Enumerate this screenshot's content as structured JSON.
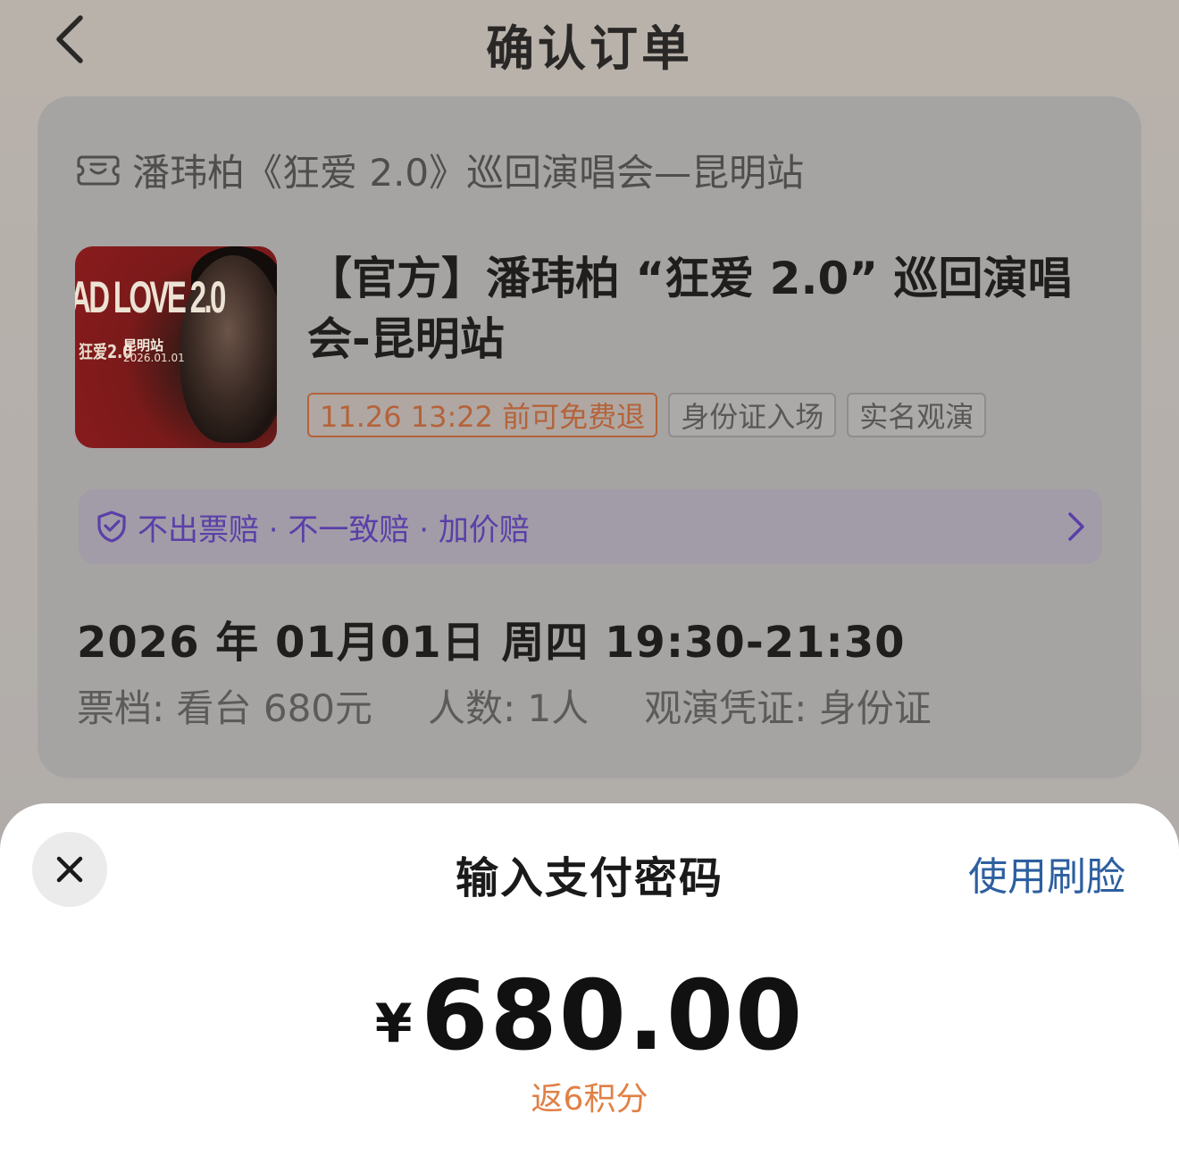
{
  "header": {
    "title": "确认订单",
    "back_icon": "chevron-left-icon"
  },
  "order": {
    "venue_icon": "ticket-icon",
    "venue_name": "潘玮柏《狂爱 2.0》巡回演唱会—昆明站",
    "poster": {
      "title_art": "AD LOVE 2.0",
      "sub_art": "狂爱2.0",
      "city_art": "昆明站",
      "date_art": "2026.01.01"
    },
    "event_title": "【官方】潘玮柏 “狂爱 2.0” 巡回演唱会-昆明站",
    "tags": [
      "11.26 13:22 前可免费退",
      "身份证入场",
      "实名观演"
    ],
    "guarantee_text": "不出票赔 · 不一致赔 · 加价赔",
    "datetime": "2026 年 01月01日 周四 19:30-21:30",
    "info": [
      "票档: 看台 680元",
      "人数: 1人",
      "观演凭证: 身份证"
    ]
  },
  "pay_sheet": {
    "close_icon": "close-icon",
    "title": "输入支付密码",
    "face_link": "使用刷脸",
    "currency": "¥",
    "amount": "680.00",
    "points_note": "返6积分"
  },
  "colors": {
    "accent_orange": "#e08045",
    "link_blue": "#2d5fa0",
    "guarantee_purple": "#5a3fa8",
    "poster_red": "#8a1b1d"
  }
}
